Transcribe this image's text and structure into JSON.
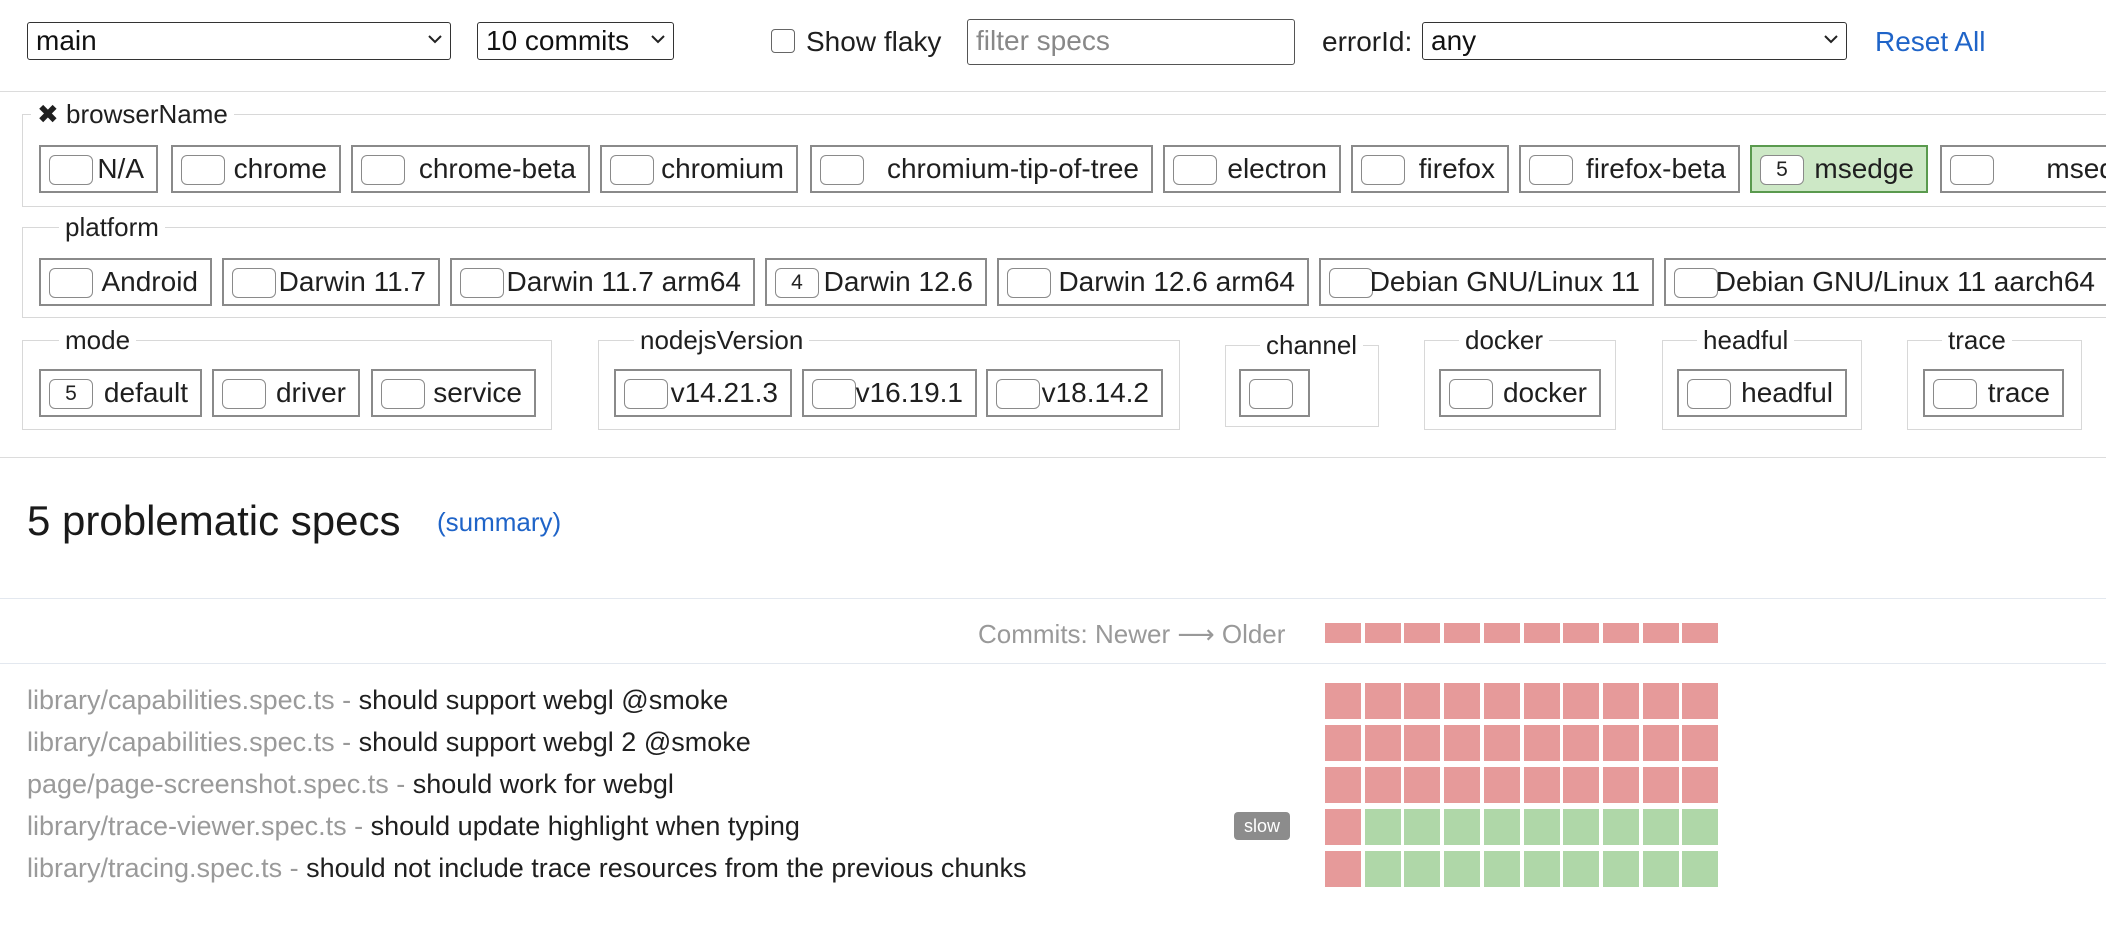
{
  "toolbar": {
    "branch": "main",
    "commits": "10 commits",
    "show_flaky_label": "Show flaky",
    "filter_placeholder": "filter specs",
    "error_id_label": "errorId:",
    "error_id_value": "any",
    "reset_all": "Reset All"
  },
  "filters": {
    "browser_name": {
      "close_glyph": "✖",
      "label": "browserName",
      "chips": [
        {
          "label": "N/A",
          "count": ""
        },
        {
          "label": "chrome",
          "count": ""
        },
        {
          "label": "chrome-beta",
          "count": ""
        },
        {
          "label": "chromium",
          "count": ""
        },
        {
          "label": "chromium-tip-of-tree",
          "count": ""
        },
        {
          "label": "electron",
          "count": ""
        },
        {
          "label": "firefox",
          "count": ""
        },
        {
          "label": "firefox-beta",
          "count": ""
        },
        {
          "label": "msedge",
          "count": "5"
        },
        {
          "label": "msedge",
          "count": ""
        }
      ]
    },
    "platform": {
      "label": "platform",
      "chips": [
        {
          "label": "Android",
          "count": ""
        },
        {
          "label": "Darwin 11.7",
          "count": ""
        },
        {
          "label": "Darwin 11.7 arm64",
          "count": ""
        },
        {
          "label": "Darwin 12.6",
          "count": "4"
        },
        {
          "label": "Darwin 12.6 arm64",
          "count": ""
        },
        {
          "label": "Debian GNU/Linux 11",
          "count": ""
        },
        {
          "label": "Debian GNU/Linux 11 aarch64",
          "count": ""
        }
      ]
    },
    "mode": {
      "label": "mode",
      "chips": [
        {
          "label": "default",
          "count": "5"
        },
        {
          "label": "driver",
          "count": ""
        },
        {
          "label": "service",
          "count": ""
        }
      ]
    },
    "nodejs_version": {
      "label": "nodejsVersion",
      "chips": [
        {
          "label": "v14.21.3",
          "count": ""
        },
        {
          "label": "v16.19.1",
          "count": ""
        },
        {
          "label": "v18.14.2",
          "count": ""
        }
      ]
    },
    "channel": {
      "label": "channel",
      "chips": [
        {
          "label": "",
          "count": ""
        }
      ]
    },
    "docker": {
      "label": "docker",
      "chips": [
        {
          "label": "docker",
          "count": ""
        }
      ]
    },
    "headful": {
      "label": "headful",
      "chips": [
        {
          "label": "headful",
          "count": ""
        }
      ]
    },
    "trace": {
      "label": "trace",
      "chips": [
        {
          "label": "trace",
          "count": ""
        }
      ]
    }
  },
  "results": {
    "heading": "5 problematic specs",
    "summary_link": "(summary)",
    "commits_header": "Commits: Newer ⟶ Older",
    "commit_count": 10,
    "specs": [
      {
        "file": "library/capabilities.spec.ts",
        "sep": " - ",
        "title": "should support webgl @smoke",
        "badge": "",
        "statuses": [
          "fail",
          "fail",
          "fail",
          "fail",
          "fail",
          "fail",
          "fail",
          "fail",
          "fail",
          "fail"
        ]
      },
      {
        "file": "library/capabilities.spec.ts",
        "sep": " - ",
        "title": "should support webgl 2 @smoke",
        "badge": "",
        "statuses": [
          "fail",
          "fail",
          "fail",
          "fail",
          "fail",
          "fail",
          "fail",
          "fail",
          "fail",
          "fail"
        ]
      },
      {
        "file": "page/page-screenshot.spec.ts",
        "sep": " - ",
        "title": "should work for webgl",
        "badge": "",
        "statuses": [
          "fail",
          "fail",
          "fail",
          "fail",
          "fail",
          "fail",
          "fail",
          "fail",
          "fail",
          "fail"
        ]
      },
      {
        "file": "library/trace-viewer.spec.ts",
        "sep": " - ",
        "title": "should update highlight when typing",
        "badge": "slow",
        "statuses": [
          "fail",
          "pass",
          "pass",
          "pass",
          "pass",
          "pass",
          "pass",
          "pass",
          "pass",
          "pass"
        ]
      },
      {
        "file": "library/tracing.spec.ts",
        "sep": " - ",
        "title": "should not include trace resources from the previous chunks",
        "badge": "",
        "statuses": [
          "fail",
          "pass",
          "pass",
          "pass",
          "pass",
          "pass",
          "pass",
          "pass",
          "pass",
          "pass"
        ]
      }
    ]
  },
  "colors": {
    "fail": "#e69a9a",
    "pass": "#afd7a8",
    "active_chip": "#cde8c6",
    "link": "#1f64c8"
  }
}
